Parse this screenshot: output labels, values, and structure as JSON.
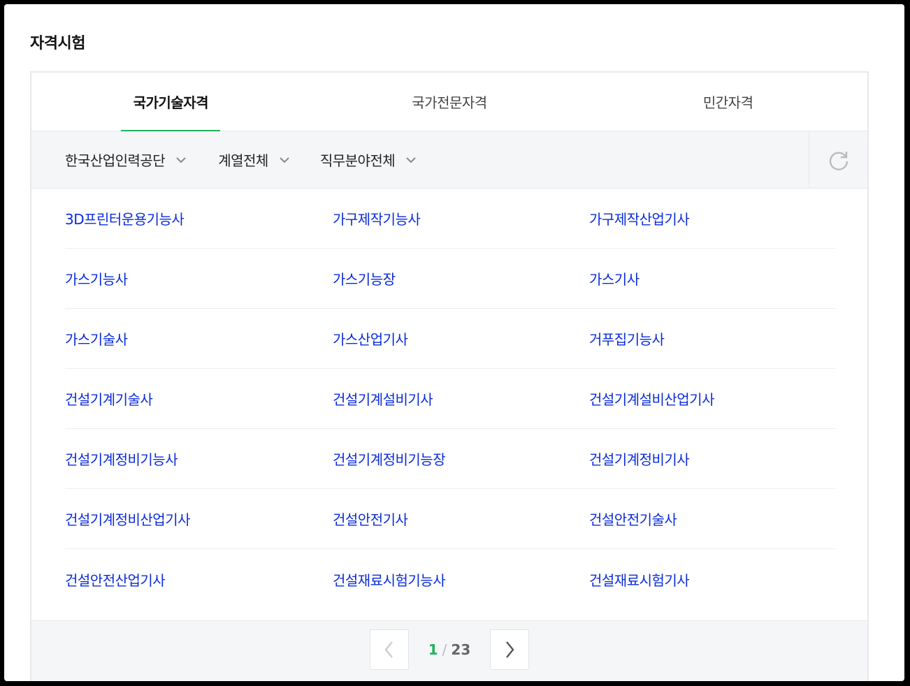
{
  "section": {
    "title": "자격시험"
  },
  "tabs": [
    {
      "label": "국가기술자격",
      "active": true
    },
    {
      "label": "국가전문자격",
      "active": false
    },
    {
      "label": "민간자격",
      "active": false
    }
  ],
  "filters": {
    "agency": "한국산업인력공단",
    "series": "계열전체",
    "field": "직무분야전체",
    "refresh_icon": "refresh-icon"
  },
  "items": [
    [
      "3D프린터운용기능사",
      "가구제작기능사",
      "가구제작산업기사"
    ],
    [
      "가스기능사",
      "가스기능장",
      "가스기사"
    ],
    [
      "가스기술사",
      "가스산업기사",
      "거푸집기능사"
    ],
    [
      "건설기계기술사",
      "건설기계설비기사",
      "건설기계설비산업기사"
    ],
    [
      "건설기계정비기능사",
      "건설기계정비기능장",
      "건설기계정비기사"
    ],
    [
      "건설기계정비산업기사",
      "건설안전기사",
      "건설안전기술사"
    ],
    [
      "건설안전산업기사",
      "건설재료시험기능사",
      "건설재료시험기사"
    ]
  ],
  "pagination": {
    "current": "1",
    "separator": "/",
    "total": "23"
  },
  "colors": {
    "accent": "#1fb45a",
    "link": "#0a2bd9",
    "panel_bg": "#f4f6f8"
  }
}
